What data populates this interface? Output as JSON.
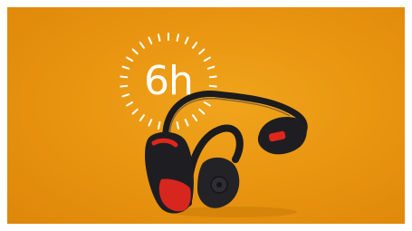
{
  "battery": {
    "hours_label": "6h"
  },
  "colors": {
    "background": "#e8930f",
    "headphones_body": "#1e1e22",
    "accent_red": "#d7261e",
    "dial_ticks": "#ffffff"
  },
  "icons": {
    "dial": "dashed-circle-dial-icon",
    "product": "bone-conduction-headphones-image"
  }
}
